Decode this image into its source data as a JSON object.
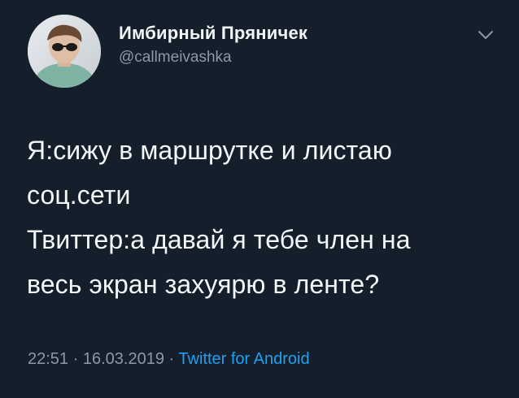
{
  "tweet": {
    "author": {
      "display_name": "Имбирный Пряничек",
      "username": "@callmeivashka",
      "avatar_icon": "user-avatar"
    },
    "menu_icon": "chevron-down-icon",
    "text_lines": [
      "Я:сижу в маршрутке и листаю",
      "соц.сети",
      "Твиттер:а давай я тебе член на",
      "весь экран захуярю в ленте?"
    ],
    "meta": {
      "time": "22:51",
      "separator": "·",
      "date": "16.03.2019",
      "source": "Twitter for Android"
    }
  },
  "colors": {
    "background": "#151f2b",
    "text": "#f5f8fa",
    "muted": "#8b98a5",
    "link": "#1da1f2"
  }
}
